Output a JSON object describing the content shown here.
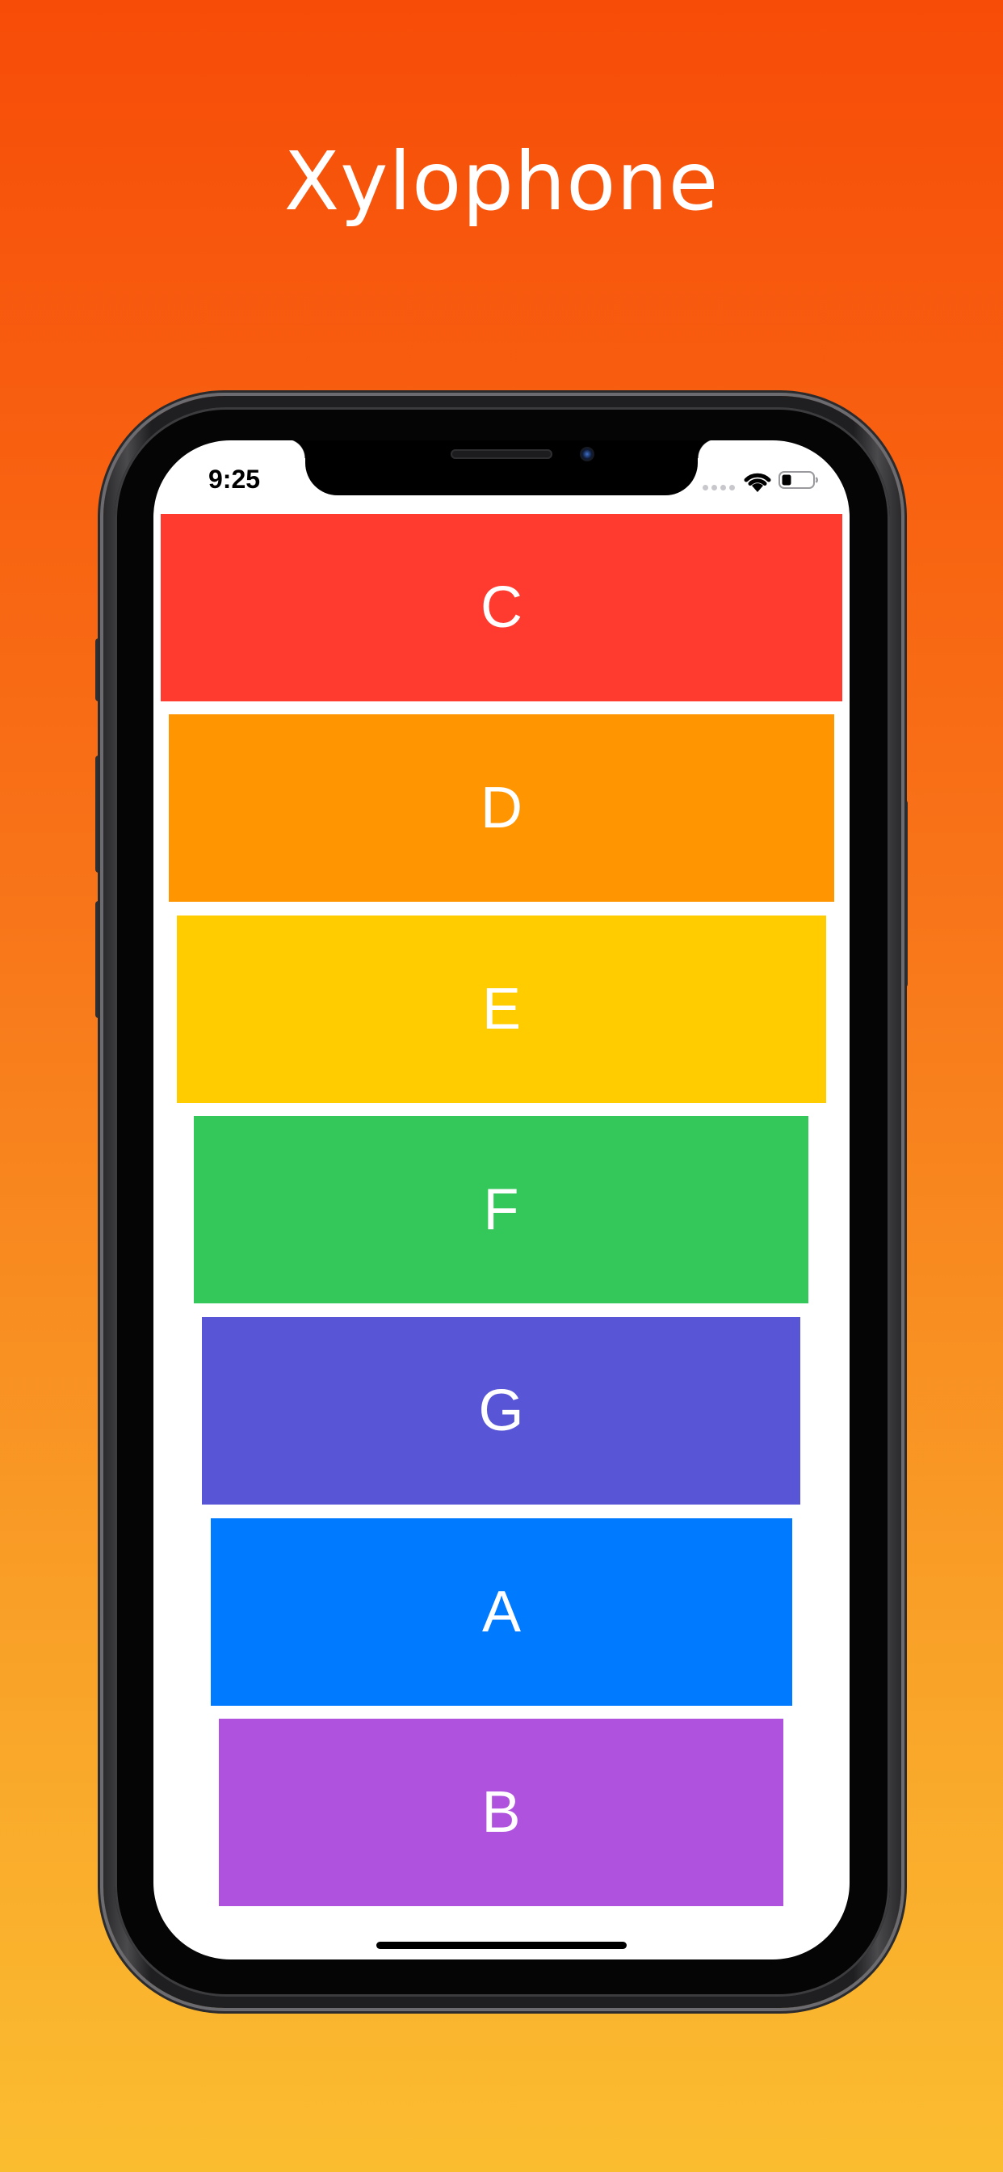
{
  "headline": "Xylophone",
  "status_bar": {
    "time": "9:25",
    "icons": [
      "signal-icon",
      "wifi-icon",
      "battery-icon"
    ]
  },
  "keys": [
    {
      "label": "C",
      "color": "#ff3b30"
    },
    {
      "label": "D",
      "color": "#ff9500"
    },
    {
      "label": "E",
      "color": "#ffcc00"
    },
    {
      "label": "F",
      "color": "#34c759"
    },
    {
      "label": "G",
      "color": "#5856d6"
    },
    {
      "label": "A",
      "color": "#007aff"
    },
    {
      "label": "B",
      "color": "#af52de"
    }
  ],
  "colors": {
    "background_top": "#f74c08",
    "background_bottom": "#fbbd30",
    "screen_background": "#ffffff"
  }
}
